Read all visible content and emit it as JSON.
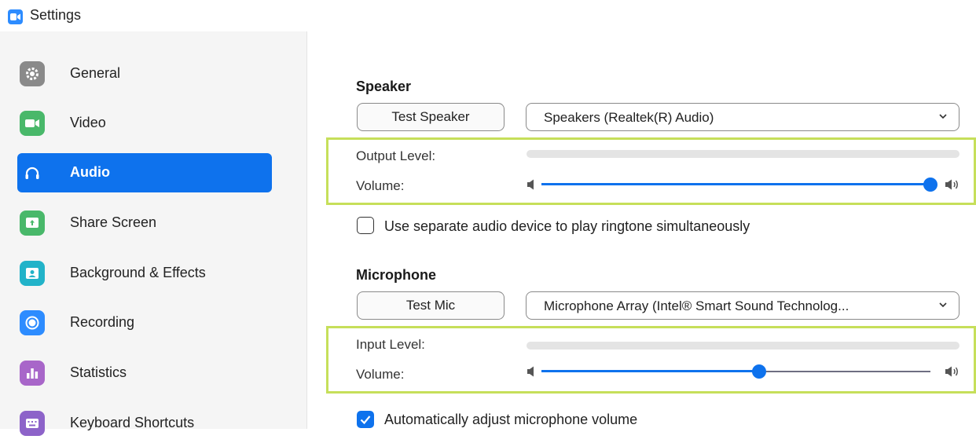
{
  "window": {
    "title": "Settings",
    "logo": "zoom-camera-icon"
  },
  "sidebar": {
    "items": [
      {
        "label": "General",
        "icon": "gear-icon",
        "active": false
      },
      {
        "label": "Video",
        "icon": "video-camera-icon",
        "active": false
      },
      {
        "label": "Audio",
        "icon": "headphones-icon",
        "active": true
      },
      {
        "label": "Share Screen",
        "icon": "share-screen-icon",
        "active": false
      },
      {
        "label": "Background & Effects",
        "icon": "background-icon",
        "active": false
      },
      {
        "label": "Recording",
        "icon": "recording-icon",
        "active": false
      },
      {
        "label": "Statistics",
        "icon": "statistics-icon",
        "active": false
      },
      {
        "label": "Keyboard Shortcuts",
        "icon": "keyboard-icon",
        "active": false
      }
    ]
  },
  "speaker": {
    "title": "Speaker",
    "test_button": "Test Speaker",
    "device": "Speakers (Realtek(R) Audio)",
    "output_level_label": "Output Level:",
    "output_level": 0,
    "volume_label": "Volume:",
    "volume": 1.0
  },
  "ringtone": {
    "label": "Use separate audio device to play ringtone simultaneously",
    "checked": false
  },
  "microphone": {
    "title": "Microphone",
    "test_button": "Test Mic",
    "device": "Microphone Array (Intel® Smart Sound Technolog...",
    "input_level_label": "Input Level:",
    "input_level": 0,
    "volume_label": "Volume:",
    "volume": 0.56
  },
  "auto_adjust": {
    "label": "Automatically adjust microphone volume",
    "checked": true
  },
  "colors": {
    "accent": "#0e72ed",
    "highlight": "#c6df5a",
    "sidebar_bg": "#f5f5f5"
  }
}
